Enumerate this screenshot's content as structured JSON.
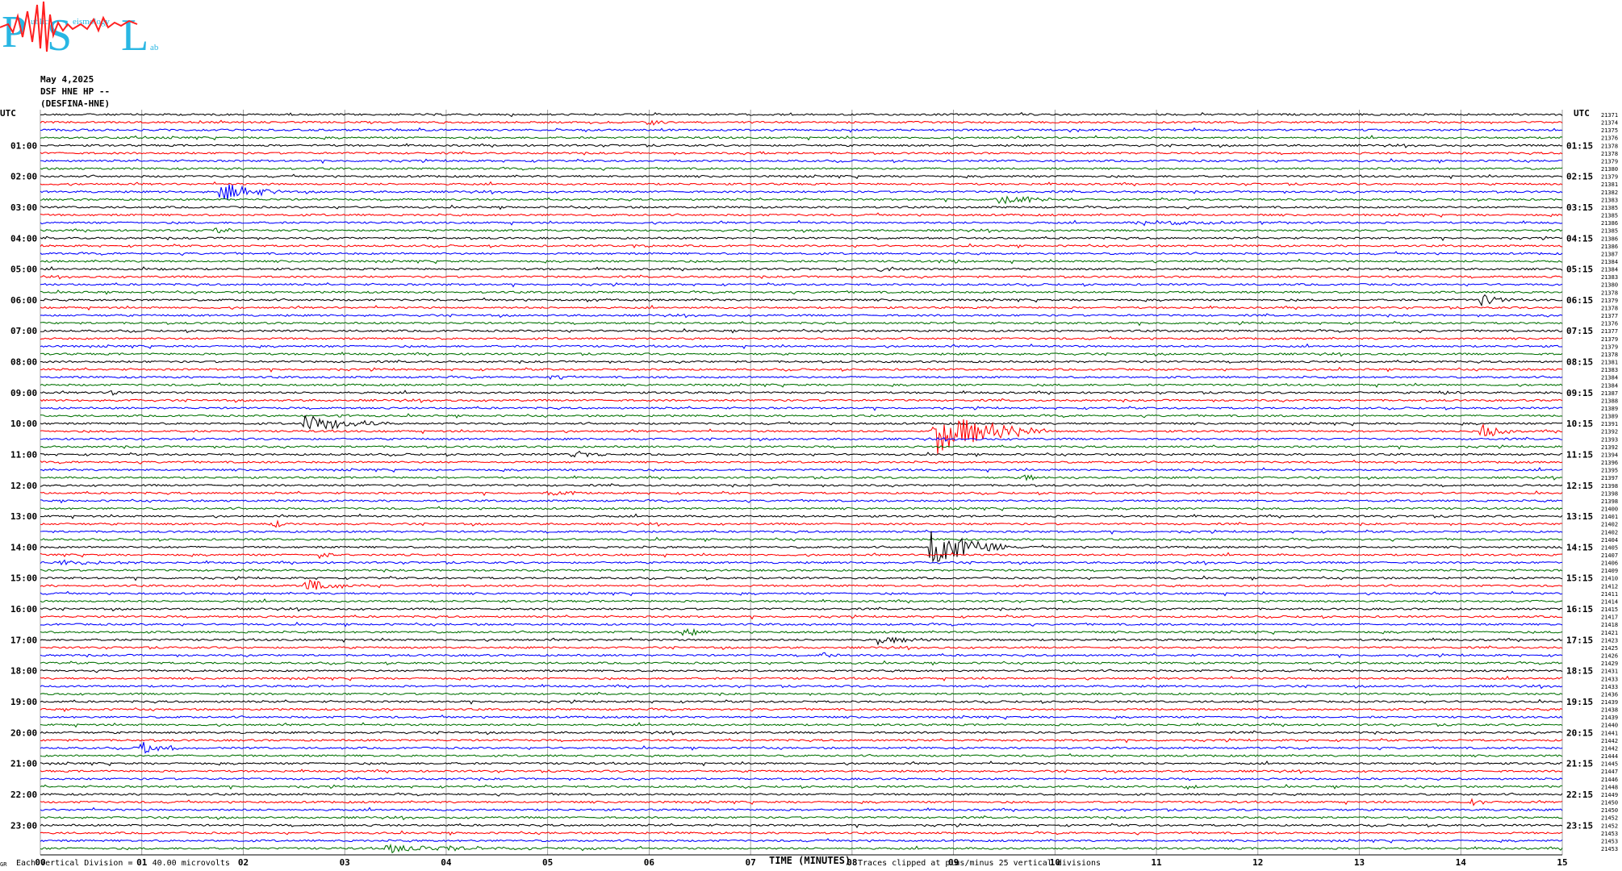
{
  "logo": {
    "letters": [
      "P",
      "S",
      "L"
    ],
    "words": [
      "ublic",
      "eismology",
      "ab"
    ],
    "colors": {
      "letters": "#29b6e3",
      "wave": "#ff2020"
    }
  },
  "header": {
    "date": "May 4,2025",
    "channel": "DSF HNE HP --",
    "station": "(DESFINA-HNE)"
  },
  "axes": {
    "left_title": "UTC",
    "right_title": "UTC",
    "left_hour_labels": [
      "01:00",
      "02:00",
      "03:00",
      "04:00",
      "05:00",
      "06:00",
      "07:00",
      "08:00",
      "09:00",
      "10:00",
      "11:00",
      "12:00",
      "13:00",
      "14:00",
      "15:00",
      "16:00",
      "17:00",
      "18:00",
      "19:00",
      "20:00",
      "21:00",
      "22:00",
      "23:00"
    ],
    "right_hour_labels": [
      "01:15",
      "02:15",
      "03:15",
      "04:15",
      "05:15",
      "06:15",
      "07:15",
      "08:15",
      "09:15",
      "10:15",
      "11:15",
      "12:15",
      "13:15",
      "14:15",
      "15:15",
      "16:15",
      "17:15",
      "18:15",
      "19:15",
      "20:15",
      "21:15",
      "22:15",
      "23:15"
    ],
    "x_ticks": [
      "00",
      "01",
      "02",
      "03",
      "04",
      "05",
      "06",
      "07",
      "08",
      "09",
      "10",
      "11",
      "12",
      "13",
      "14",
      "15"
    ]
  },
  "footer": {
    "division": "Each Vertical Division =    40.00 microvolts",
    "xlabel": "TIME (MINUTES)",
    "clip_note": "Traces clipped at plus/minus 25 vertical divisions",
    "corner": "GR"
  },
  "chart_data": {
    "type": "line",
    "title": "May 4,2025 DSF HNE HP -- (DESFINA-HNE)",
    "xlabel": "TIME (MINUTES)",
    "ylabel": "UTC",
    "xlim": [
      0,
      15
    ],
    "grid": true,
    "rows": 96,
    "row_minutes": 15,
    "trace_colors": [
      "#000000",
      "#ff0000",
      "#0000ff",
      "#007000"
    ],
    "right_counts": [
      21371,
      21374,
      21375,
      21376,
      21378,
      21378,
      21379,
      21380,
      21379,
      21381,
      21382,
      21383,
      21385,
      21385,
      21386,
      21385,
      21386,
      21386,
      21387,
      21384,
      21384,
      21383,
      21380,
      21378,
      21379,
      21378,
      21377,
      21376,
      21377,
      21379,
      21379,
      21378,
      21381,
      21383,
      21384,
      21384,
      21387,
      21388,
      21389,
      21389,
      21391,
      21392,
      21393,
      21392,
      21394,
      21396,
      21395,
      21397,
      21398,
      21398,
      21398,
      21400,
      21401,
      21402,
      21402,
      21404,
      21405,
      21407,
      21406,
      21409,
      21410,
      21412,
      21411,
      21414,
      21415,
      21417,
      21418,
      21421,
      21423,
      21425,
      21426,
      21429,
      21431,
      21433,
      21433,
      21436,
      21439,
      21438,
      21439,
      21440,
      21441,
      21442,
      21442,
      21444,
      21445,
      21447,
      21446,
      21448,
      21449,
      21450,
      21450,
      21452,
      21452,
      21453,
      21453,
      21453
    ],
    "events": [
      {
        "row": 1,
        "minute": 6.0,
        "amplitude": 1.2,
        "duration": 0.12
      },
      {
        "row": 5,
        "minute": 7.05,
        "amplitude": 0.6,
        "duration": 0.1
      },
      {
        "row": 10,
        "minute": 1.78,
        "amplitude": 4.0,
        "duration": 0.3
      },
      {
        "row": 11,
        "minute": 9.4,
        "amplitude": 1.8,
        "duration": 0.35
      },
      {
        "row": 14,
        "minute": 10.8,
        "amplitude": 0.8,
        "duration": 1.0
      },
      {
        "row": 15,
        "minute": 1.72,
        "amplitude": 1.6,
        "duration": 0.1
      },
      {
        "row": 17,
        "minute": 5.8,
        "amplitude": 0.6,
        "duration": 0.15
      },
      {
        "row": 19,
        "minute": 8.85,
        "amplitude": 1.2,
        "duration": 0.15
      },
      {
        "row": 20,
        "minute": 8.25,
        "amplitude": 1.5,
        "duration": 0.12
      },
      {
        "row": 20,
        "minute": 1.0,
        "amplitude": 0.8,
        "duration": 0.12
      },
      {
        "row": 24,
        "minute": 14.2,
        "amplitude": 2.6,
        "duration": 0.15
      },
      {
        "row": 24,
        "minute": 5.4,
        "amplitude": 1.0,
        "duration": 0.1
      },
      {
        "row": 34,
        "minute": 5.0,
        "amplitude": 1.0,
        "duration": 0.2
      },
      {
        "row": 36,
        "minute": 0.7,
        "amplitude": 1.2,
        "duration": 0.1
      },
      {
        "row": 36,
        "minute": 13.8,
        "amplitude": 1.0,
        "duration": 0.15
      },
      {
        "row": 39,
        "minute": 2.95,
        "amplitude": 1.0,
        "duration": 0.1
      },
      {
        "row": 40,
        "minute": 2.6,
        "amplitude": 3.5,
        "duration": 0.4
      },
      {
        "row": 41,
        "minute": 8.8,
        "amplitude": 9.0,
        "duration": 0.5
      },
      {
        "row": 41,
        "minute": 14.2,
        "amplitude": 4.0,
        "duration": 0.15
      },
      {
        "row": 44,
        "minute": 5.25,
        "amplitude": 1.5,
        "duration": 0.15
      },
      {
        "row": 46,
        "minute": 11.3,
        "amplitude": 0.8,
        "duration": 0.1
      },
      {
        "row": 47,
        "minute": 9.7,
        "amplitude": 1.2,
        "duration": 0.15
      },
      {
        "row": 49,
        "minute": 5.0,
        "amplitude": 1.2,
        "duration": 0.15
      },
      {
        "row": 53,
        "minute": 2.3,
        "amplitude": 2.0,
        "duration": 0.1
      },
      {
        "row": 56,
        "minute": 8.78,
        "amplitude": 8.0,
        "duration": 0.35
      },
      {
        "row": 57,
        "minute": 2.75,
        "amplitude": 1.2,
        "duration": 0.1
      },
      {
        "row": 58,
        "minute": 0.1,
        "amplitude": 1.0,
        "duration": 0.5
      },
      {
        "row": 61,
        "minute": 2.6,
        "amplitude": 2.2,
        "duration": 0.35
      },
      {
        "row": 67,
        "minute": 6.35,
        "amplitude": 2.0,
        "duration": 0.12
      },
      {
        "row": 68,
        "minute": 8.25,
        "amplitude": 1.8,
        "duration": 0.3
      },
      {
        "row": 70,
        "minute": 7.7,
        "amplitude": 0.8,
        "duration": 0.2
      },
      {
        "row": 82,
        "minute": 1.0,
        "amplitude": 2.5,
        "duration": 0.25
      },
      {
        "row": 87,
        "minute": 11.3,
        "amplitude": 0.8,
        "duration": 0.1
      },
      {
        "row": 89,
        "minute": 14.1,
        "amplitude": 1.2,
        "duration": 0.15
      },
      {
        "row": 95,
        "minute": 3.4,
        "amplitude": 1.5,
        "duration": 1.0
      }
    ]
  }
}
